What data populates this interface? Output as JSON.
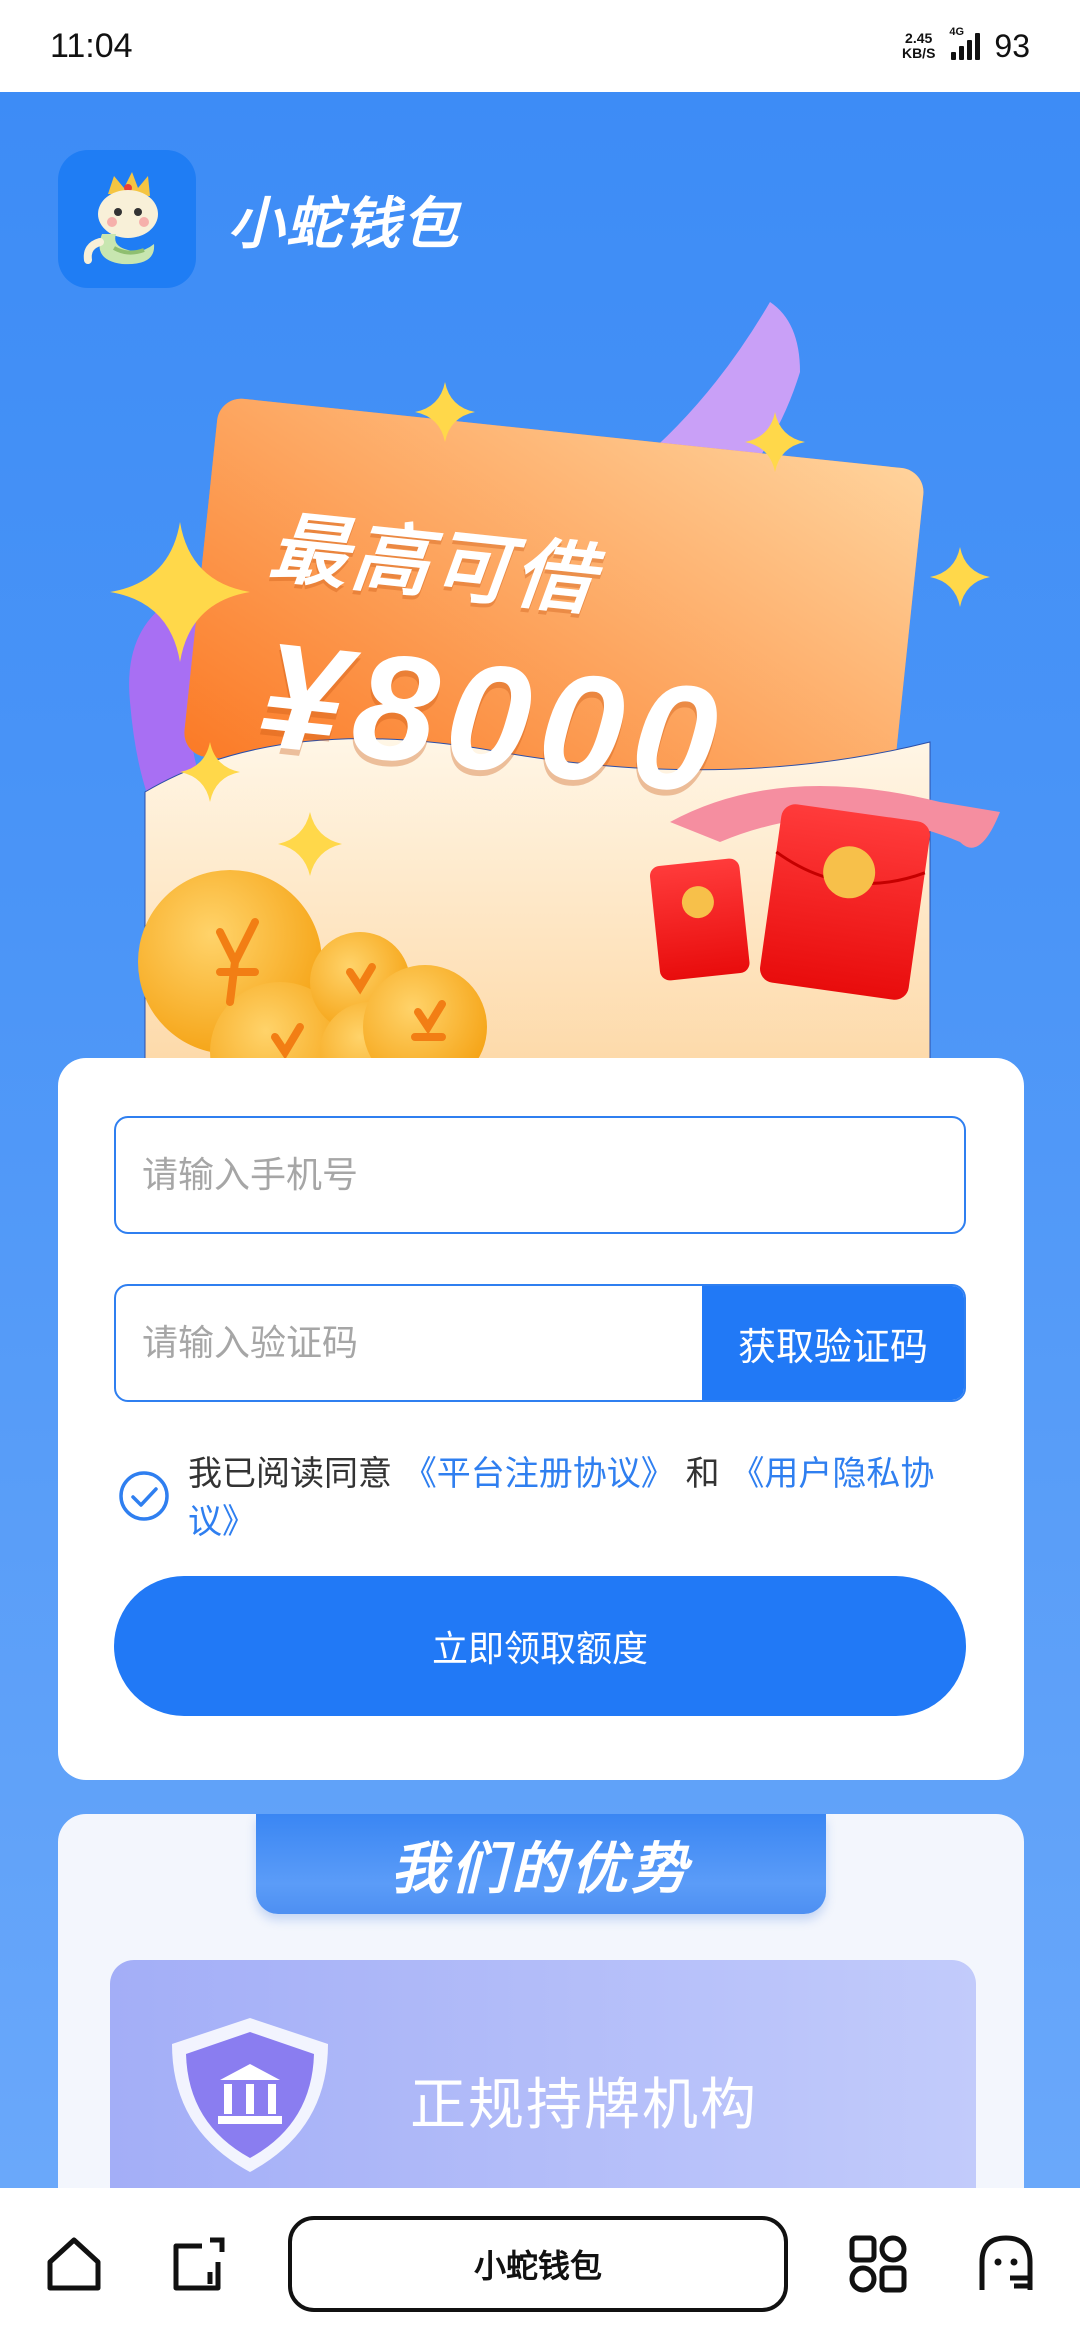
{
  "status_bar": {
    "time": "11:04",
    "net_speed_value": "2.45",
    "net_speed_unit": "KB/S",
    "network_type": "4G",
    "battery": "93"
  },
  "header": {
    "app_name": "小蛇钱包"
  },
  "hero": {
    "headline": "最高可借",
    "amount": "¥8000"
  },
  "form": {
    "phone_placeholder": "请输入手机号",
    "code_placeholder": "请输入验证码",
    "get_code_label": "获取验证码",
    "agreement_prefix": "我已阅读同意",
    "agreement_link1": "《平台注册协议》",
    "agreement_and": "和",
    "agreement_link2": "《用户隐私协议》",
    "agreement_checked": true,
    "submit_label": "立即领取额度"
  },
  "advantages": {
    "title": "我们的优势",
    "items": [
      {
        "label": "正规持牌机构",
        "icon": "bank-shield-icon"
      }
    ]
  },
  "bottom_bar": {
    "center_label": "小蛇钱包",
    "icons": [
      "home-icon",
      "tabs-icon",
      "apps-icon",
      "profile-icon"
    ]
  },
  "colors": {
    "primary": "#2179f6",
    "background_top": "#3d8cf6",
    "link": "#2f7ff0"
  }
}
